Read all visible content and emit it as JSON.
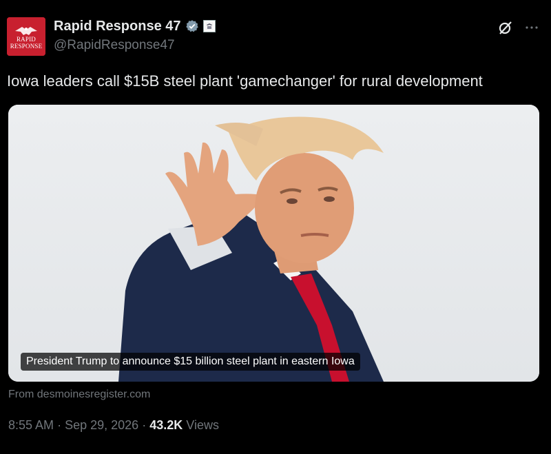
{
  "author": {
    "display_name": "Rapid Response 47",
    "handle": "@RapidResponse47",
    "avatar_text_line1": "RAPID",
    "avatar_text_line2": "RESPONSE",
    "verified_color": "#829aab",
    "brand_color": "#c8202f"
  },
  "tweet": {
    "text": "Iowa leaders call $15B steel plant 'gamechanger' for rural development"
  },
  "card": {
    "caption": "President Trump to announce $15 billion steel plant in eastern Iowa",
    "source": "From desmoinesregister.com"
  },
  "meta": {
    "time": "8:55 AM",
    "date": "Sep 29, 2026",
    "separator": "·",
    "views_count": "43.2K",
    "views_label": "Views"
  },
  "icons": {
    "grok": "grok-slash-circle-icon",
    "more": "more-dots-icon",
    "verified": "verified-badge-icon",
    "affiliate": "affiliate-seal-icon"
  }
}
